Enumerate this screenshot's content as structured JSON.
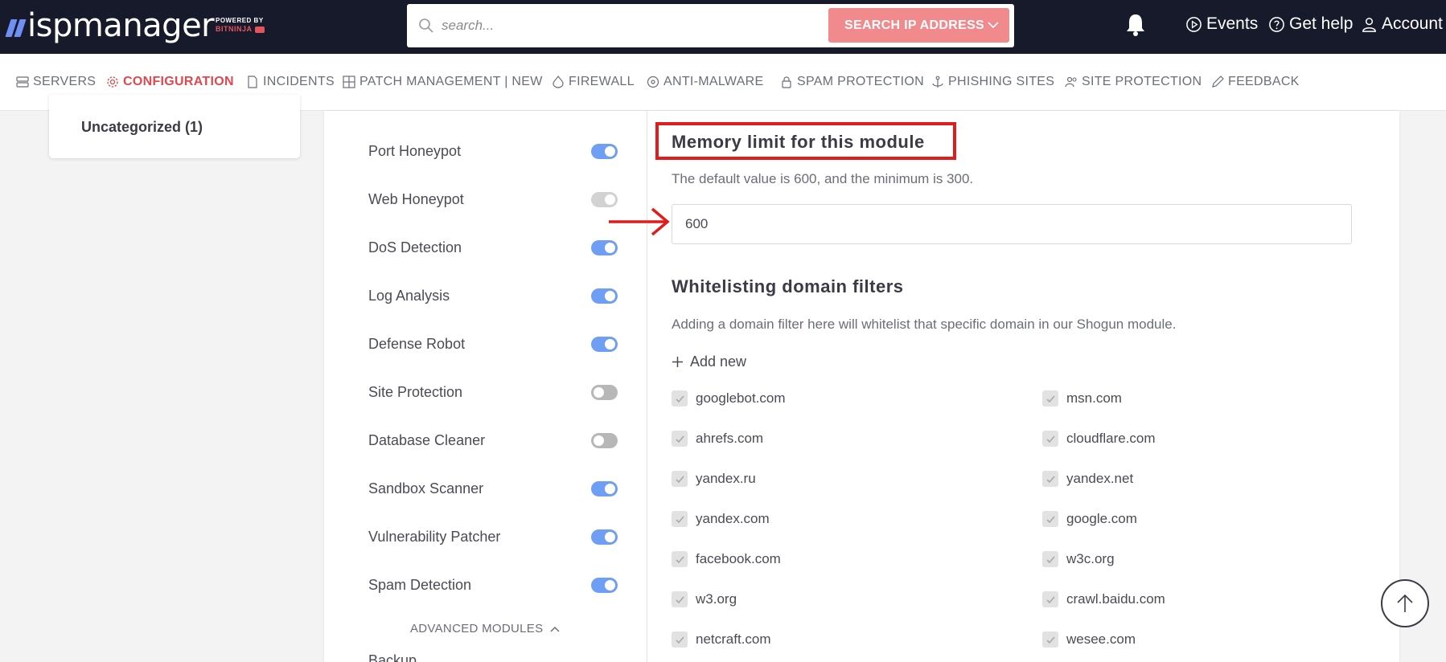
{
  "header": {
    "logo_text": "ispmanager",
    "powered_by": "POWERED BY",
    "powered_brand": "BITNINJA",
    "search": {
      "placeholder": "search...",
      "button_label": "SEARCH IP ADDRESS"
    },
    "links": {
      "events": "Events",
      "help": "Get help",
      "account": "Account"
    }
  },
  "nav": {
    "items": [
      {
        "label": "SERVERS",
        "icon": "server-icon"
      },
      {
        "label": "CONFIGURATION",
        "icon": "gear-icon",
        "active": true
      },
      {
        "label": "INCIDENTS",
        "icon": "document-icon"
      },
      {
        "label": "PATCH MANAGEMENT | NEW",
        "icon": "grid-icon"
      },
      {
        "label": "FIREWALL",
        "icon": "flame-icon"
      },
      {
        "label": "ANTI-MALWARE",
        "icon": "biohazard-icon"
      },
      {
        "label": "SPAM PROTECTION",
        "icon": "lock-icon"
      },
      {
        "label": "PHISHING SITES",
        "icon": "anchor-icon"
      },
      {
        "label": "SITE PROTECTION",
        "icon": "users-icon"
      },
      {
        "label": "FEEDBACK",
        "icon": "pencil-icon"
      }
    ]
  },
  "sidebar": {
    "category": "Uncategorized (1)"
  },
  "modules": {
    "items": [
      {
        "name": "Port Honeypot",
        "state": "on"
      },
      {
        "name": "Web Honeypot",
        "state": "disabled"
      },
      {
        "name": "DoS Detection",
        "state": "on"
      },
      {
        "name": "Log Analysis",
        "state": "on"
      },
      {
        "name": "Defense Robot",
        "state": "on"
      },
      {
        "name": "Site Protection",
        "state": "off"
      },
      {
        "name": "Database Cleaner",
        "state": "off"
      },
      {
        "name": "Sandbox Scanner",
        "state": "on"
      },
      {
        "name": "Vulnerability Patcher",
        "state": "on"
      },
      {
        "name": "Spam Detection",
        "state": "on"
      }
    ],
    "advanced_label": "ADVANCED MODULES",
    "next_item": "Backup"
  },
  "memory": {
    "title": "Memory limit for this module",
    "description": "The default value is 600, and the minimum is 300.",
    "value": "600"
  },
  "whitelist": {
    "title": "Whitelisting domain filters",
    "description": "Adding a domain filter here will whitelist that specific domain in our Shogun module.",
    "add_new": "Add new",
    "domains": [
      "googlebot.com",
      "msn.com",
      "ahrefs.com",
      "cloudflare.com",
      "yandex.ru",
      "yandex.net",
      "yandex.com",
      "google.com",
      "facebook.com",
      "w3c.org",
      "w3.org",
      "crawl.baidu.com",
      "netcraft.com",
      "wesee.com"
    ]
  },
  "colors": {
    "topbar": "#161a2b",
    "accent_red": "#e0484e",
    "search_button": "#f18a8c",
    "toggle_on": "#6f9ef5",
    "highlight": "#e01c1c"
  }
}
